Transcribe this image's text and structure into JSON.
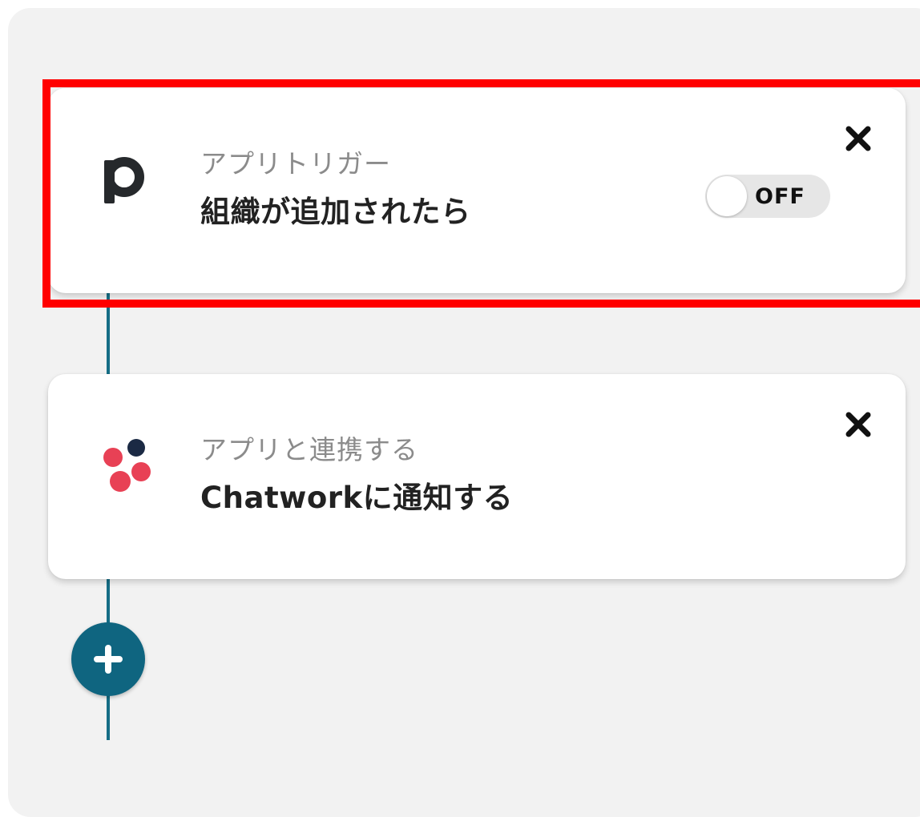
{
  "flow": {
    "steps": [
      {
        "app": "pipedrive",
        "icon": "pipedrive-p-icon",
        "subtitle": "アプリトリガー",
        "title": "組織が追加されたら",
        "toggle": {
          "label": "OFF",
          "state": "off"
        },
        "highlighted": true
      },
      {
        "app": "chatwork",
        "icon": "chatwork-logo-icon",
        "subtitle": "アプリと連携する",
        "title": "Chatworkに通知する"
      }
    ]
  },
  "colors": {
    "canvas_bg": "#f2f2f2",
    "connector": "#166e86",
    "add_button": "#0f6580",
    "highlight": "#ff0000",
    "chatwork_red": "#e84155",
    "chatwork_navy": "#1b2a44",
    "toggle_off_bg": "#e6e6e6"
  },
  "icons": {
    "close": "close-icon",
    "add": "plus-icon"
  }
}
